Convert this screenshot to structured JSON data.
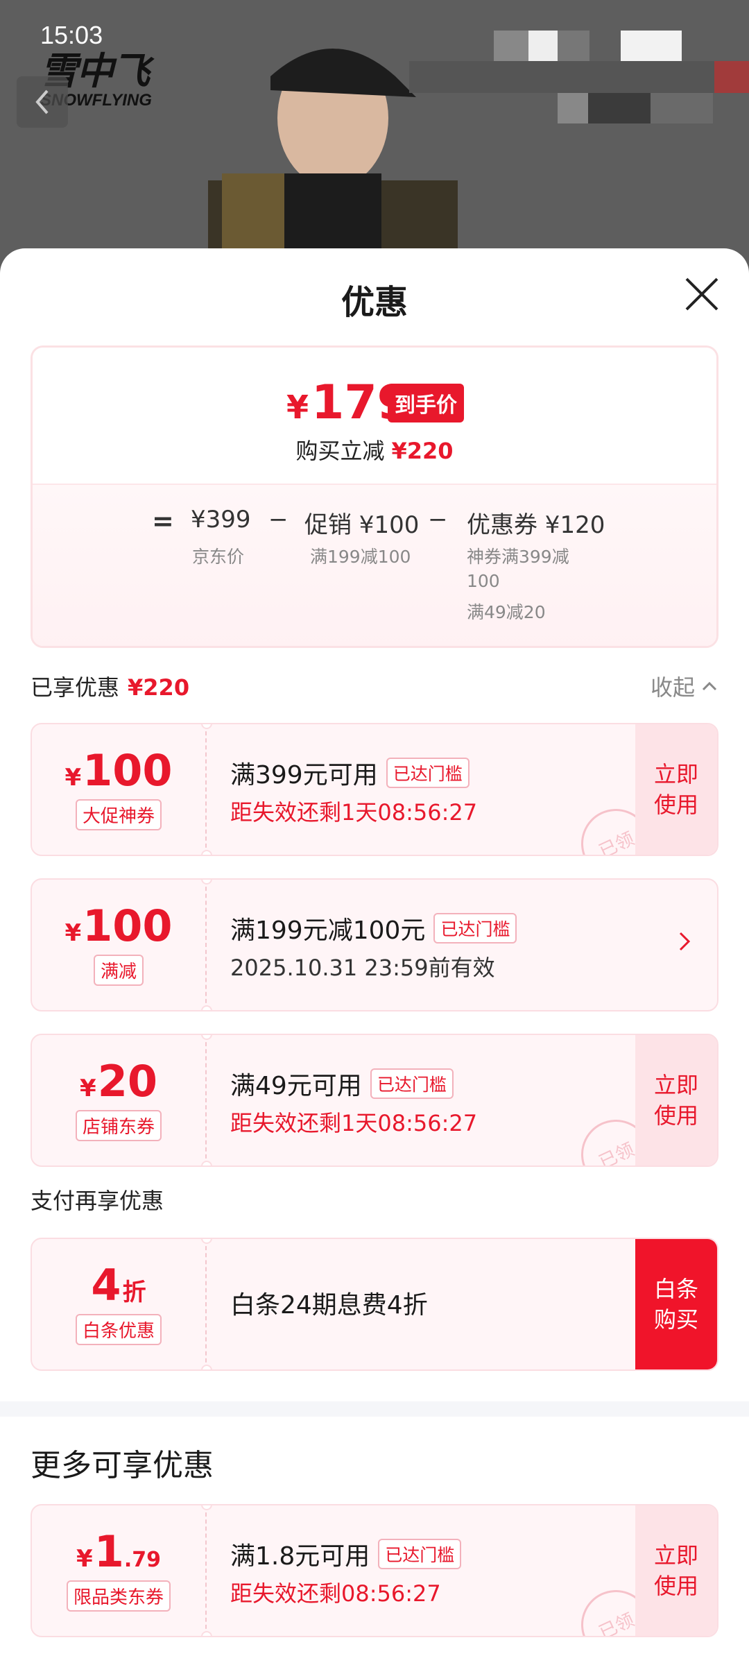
{
  "status_bar": {
    "time": "15:03"
  },
  "brand": {
    "name_cn": "雪中飞",
    "name_en": "SNOWFLYING"
  },
  "sheet": {
    "title": "优惠"
  },
  "summary": {
    "final_price": "179",
    "currency": "¥",
    "final_tag": "到手价",
    "save_label": "购买立减",
    "save_amount": "¥220",
    "equals": "=",
    "minus": "−",
    "jd_price": "¥399",
    "jd_price_label": "京东价",
    "promo": "促销 ¥100",
    "promo_note": "满199减100",
    "coupon": "优惠券 ¥120",
    "coupon_note_1": "神券满399减",
    "coupon_note_2": "100",
    "coupon_note_3": "满49减20"
  },
  "enjoyed": {
    "label": "已享优惠",
    "amount": "¥220",
    "collapse_label": "收起"
  },
  "coupons": [
    {
      "yen": "¥",
      "value": "100",
      "type": "大促神券",
      "condition": "满399元可用",
      "met": "已达门槛",
      "sub": "距失效还剩1天08:56:27",
      "action": "立即使用",
      "stamp": "已领"
    },
    {
      "yen": "¥",
      "value": "100",
      "type": "满减",
      "condition": "满199元减100元",
      "met": "已达门槛",
      "sub": "2025.10.31 23:59前有效"
    },
    {
      "yen": "¥",
      "value": "20",
      "type": "店铺东券",
      "condition": "满49元可用",
      "met": "已达门槛",
      "sub": "距失效还剩1天08:56:27",
      "action": "立即使用",
      "stamp": "已领"
    }
  ],
  "pay_section": {
    "label": "支付再享优惠"
  },
  "baitiao": {
    "value": "4",
    "unit": "折",
    "type": "白条优惠",
    "text": "白条24期息费4折",
    "action": "白条购买"
  },
  "more": {
    "title": "更多可享优惠",
    "coupon": {
      "yen": "¥",
      "value_int": "1",
      "value_dec": ".79",
      "type": "限品类东券",
      "condition": "满1.8元可用",
      "met": "已达门槛",
      "sub": "距失效还剩08:56:27",
      "action": "立即使用",
      "stamp": "已领"
    }
  },
  "colors": {
    "accent": "#e8182c",
    "card_bg": "#fff5f7"
  }
}
